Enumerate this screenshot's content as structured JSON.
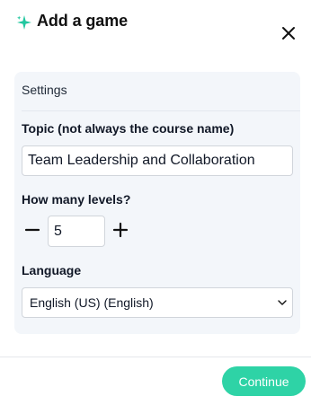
{
  "dialog": {
    "title": "Add a game",
    "icons": {
      "title_icon": "sparkle-icon",
      "close_icon": "close-icon"
    }
  },
  "settings": {
    "header": "Settings",
    "topic": {
      "label": "Topic (not always the course name)",
      "value": "Team Leadership and Collaboration"
    },
    "levels": {
      "label": "How many levels?",
      "value": "5",
      "decrement_icon": "minus-icon",
      "increment_icon": "plus-icon"
    },
    "language": {
      "label": "Language",
      "selected": "English (US) (English)",
      "dropdown_icon": "chevron-down-icon"
    }
  },
  "footer": {
    "continue_label": "Continue"
  },
  "colors": {
    "accent": "#2ed3a6",
    "sparkle": "#22c7a0",
    "card_background": "#f3f6fa"
  }
}
